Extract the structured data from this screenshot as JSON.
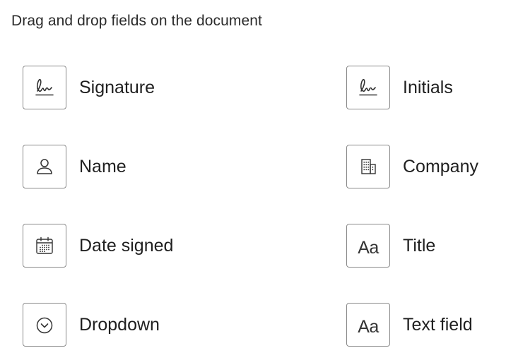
{
  "header": {
    "instructions": "Drag and drop fields on the document"
  },
  "fields": [
    {
      "label": "Signature",
      "icon": "signature-icon"
    },
    {
      "label": "Initials",
      "icon": "signature-icon"
    },
    {
      "label": "Name",
      "icon": "person-icon"
    },
    {
      "label": "Company",
      "icon": "building-icon"
    },
    {
      "label": "Date signed",
      "icon": "calendar-icon"
    },
    {
      "label": "Title",
      "icon": "text-aa-icon"
    },
    {
      "label": "Dropdown",
      "icon": "chevron-circle-icon"
    },
    {
      "label": "Text field",
      "icon": "text-aa-icon"
    }
  ],
  "icon_text": {
    "aa": "Aa"
  }
}
